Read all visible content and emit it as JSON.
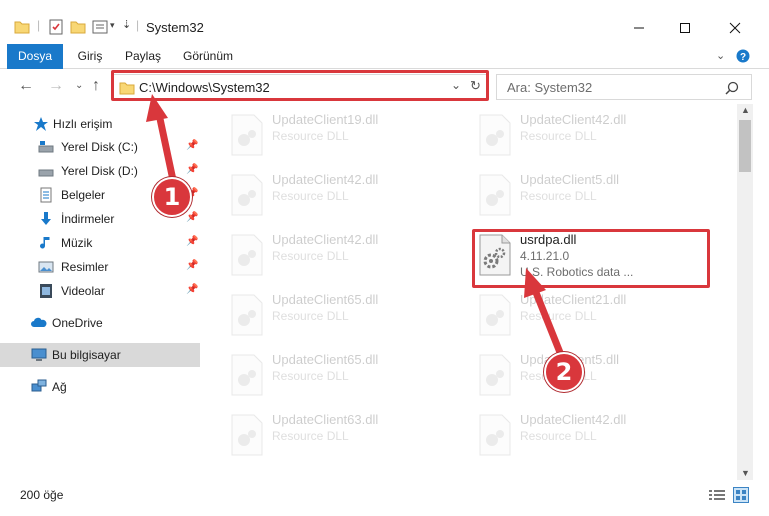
{
  "window": {
    "title": "System32",
    "controls": [
      "minimize-icon",
      "maximize-icon",
      "close-icon"
    ]
  },
  "ribbon": {
    "tabs": [
      "Dosya",
      "Giriş",
      "Paylaş",
      "Görünüm"
    ],
    "file_tab_color": "#1979ca"
  },
  "address_bar": {
    "path": "C:\\Windows\\System32"
  },
  "search": {
    "placeholder": "Ara: System32"
  },
  "nav_pane": {
    "items": [
      {
        "label": "Hızlı erişim",
        "icon": "star-icon",
        "pinned": false
      },
      {
        "label": "Yerel Disk (C:)",
        "icon": "drive-icon",
        "pinned": true
      },
      {
        "label": "Yerel Disk (D:)",
        "icon": "drive-icon",
        "pinned": true
      },
      {
        "label": "Belgeler",
        "icon": "documents-icon",
        "pinned": true
      },
      {
        "label": "İndirmeler",
        "icon": "download-icon",
        "pinned": true
      },
      {
        "label": "Müzik",
        "icon": "music-icon",
        "pinned": true
      },
      {
        "label": "Resimler",
        "icon": "pictures-icon",
        "pinned": true
      },
      {
        "label": "Videolar",
        "icon": "video-icon",
        "pinned": true
      },
      {
        "label": "OneDrive",
        "icon": "cloud-icon",
        "pinned": false
      },
      {
        "label": "Bu bilgisayar",
        "icon": "computer-icon",
        "pinned": false,
        "selected": true
      },
      {
        "label": "Ağ",
        "icon": "network-icon",
        "pinned": false
      }
    ]
  },
  "files": [
    {
      "name": "UpdateClient19.dll",
      "desc": "Resource DLL"
    },
    {
      "name": "UpdateClient42.dll",
      "desc": "Resource DLL"
    },
    {
      "name": "UpdateClient42.dll",
      "desc": "Resource DLL"
    },
    {
      "name": "UpdateClient5.dll",
      "desc": "Resource DLL"
    },
    {
      "name": "UpdateClient42.dll",
      "desc": "Resource DLL"
    },
    {
      "name": "usrdpa.dll",
      "desc": "4.11.21.0",
      "desc2": "U.S. Robotics data ...",
      "highlighted": true
    },
    {
      "name": "UpdateClient65.dll",
      "desc": "Resource DLL"
    },
    {
      "name": "UpdateClient21.dll",
      "desc": "Resource DLL"
    },
    {
      "name": "UpdateClient65.dll",
      "desc": "Resource DLL"
    },
    {
      "name": "UpdateClient5.dll",
      "desc": "Resource DLL"
    },
    {
      "name": "UpdateClient63.dll",
      "desc": "Resource DLL"
    },
    {
      "name": "UpdateClient42.dll",
      "desc": "Resource DLL"
    }
  ],
  "status": {
    "item_count": "200 öğe"
  },
  "annotations": {
    "badge1": "1",
    "badge2": "2",
    "color": "#d9373c"
  }
}
